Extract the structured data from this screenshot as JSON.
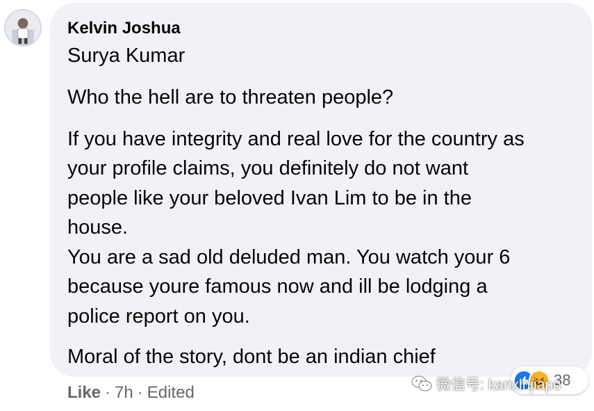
{
  "comment": {
    "author": "Kelvin Joshua",
    "mention": "Surya Kumar",
    "paragraphs": [
      "Who the hell are to threaten people?",
      "If you have integrity and real love for the country as\nyour profile claims, you definitely do not want\npeople like your beloved Ivan Lim to be in the\nhouse.",
      "You are a sad old deluded man. You watch your 6\nbecause youre famous now and ill be lodging a\npolice report on you.",
      "Moral of the story, dont be an indian chief"
    ]
  },
  "reactions": {
    "icons": [
      "like-react-icon",
      "haha-react-icon"
    ],
    "count": "38",
    "colors": {
      "like": "#1877f2",
      "haha": "#f7b125"
    }
  },
  "footer": {
    "like_label": "Like",
    "separator": "·",
    "time": "7h",
    "edited": "Edited"
  },
  "watermark": {
    "text": "微信号: kanxinjiapo",
    "icon": "wechat-icon"
  },
  "colors": {
    "bubble": "#f0f2f5",
    "text": "#050505",
    "secondary": "#65676b"
  }
}
